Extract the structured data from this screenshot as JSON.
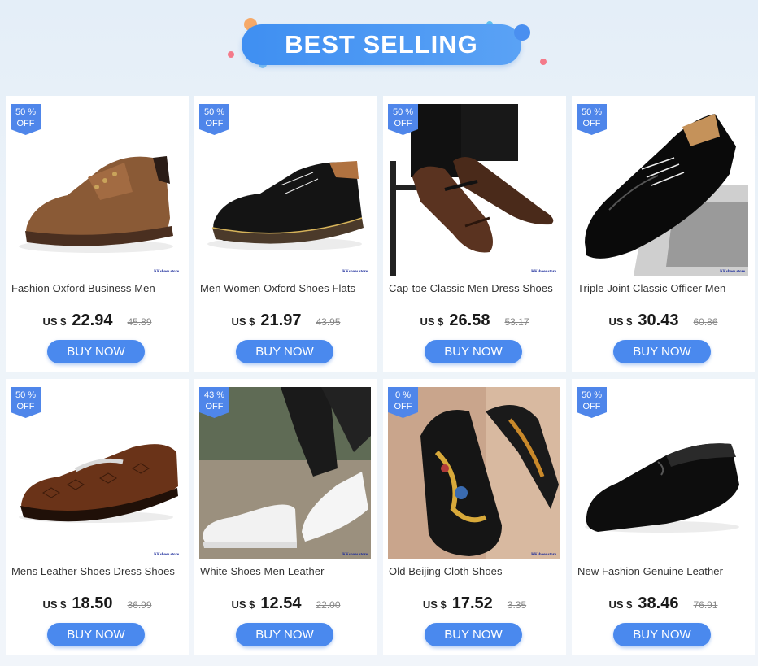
{
  "header": {
    "title": "BEST SELLING"
  },
  "colors": {
    "accent": "#4a89ee",
    "badge": "#4f86ea",
    "bg": "#e8f0f8"
  },
  "products": [
    {
      "badge": [
        "50 %",
        "OFF"
      ],
      "title": "Fashion Oxford Business Men",
      "currency": "US $",
      "price": "22.94",
      "old": "45.89",
      "buy": "BUY NOW",
      "store": "KKshoes store",
      "image": "brown-boot"
    },
    {
      "badge": [
        "50 %",
        "OFF"
      ],
      "title": "Men Women Oxford Shoes Flats",
      "currency": "US $",
      "price": "21.97",
      "old": "43.95",
      "buy": "BUY NOW",
      "store": "KKshoes store",
      "image": "black-derby"
    },
    {
      "badge": [
        "50 %",
        "OFF"
      ],
      "title": "Cap-toe Classic Men Dress Shoes",
      "currency": "US $",
      "price": "26.58",
      "old": "53.17",
      "buy": "BUY NOW",
      "store": "KKshoes store",
      "image": "brown-captoe"
    },
    {
      "badge": [
        "50 %",
        "OFF"
      ],
      "title": "Triple Joint Classic Officer Men",
      "currency": "US $",
      "price": "30.43",
      "old": "60.86",
      "buy": "BUY NOW",
      "store": "KKshoes store",
      "image": "patent-oxford"
    },
    {
      "badge": [
        "50 %",
        "OFF"
      ],
      "title": "Mens Leather Shoes Dress Shoes",
      "currency": "US $",
      "price": "18.50",
      "old": "36.99",
      "buy": "BUY NOW",
      "store": "KKshoes store",
      "image": "croc-loafer"
    },
    {
      "badge": [
        "43 %",
        "OFF"
      ],
      "title": "White Shoes Men Leather",
      "currency": "US $",
      "price": "12.54",
      "old": "22.00",
      "buy": "BUY NOW",
      "store": "KKshoes store",
      "image": "white-sneaker"
    },
    {
      "badge": [
        "0 %",
        "OFF"
      ],
      "title": "Old Beijing Cloth Shoes",
      "currency": "US $",
      "price": "17.52",
      "old": "3.35",
      "buy": "BUY NOW",
      "store": "KKshoes store",
      "image": "embroidered-slipon"
    },
    {
      "badge": [
        "50 %",
        "OFF"
      ],
      "title": "New Fashion Genuine Leather",
      "currency": "US $",
      "price": "38.46",
      "old": "76.91",
      "buy": "BUY NOW",
      "store": "",
      "image": "black-loafer"
    }
  ]
}
